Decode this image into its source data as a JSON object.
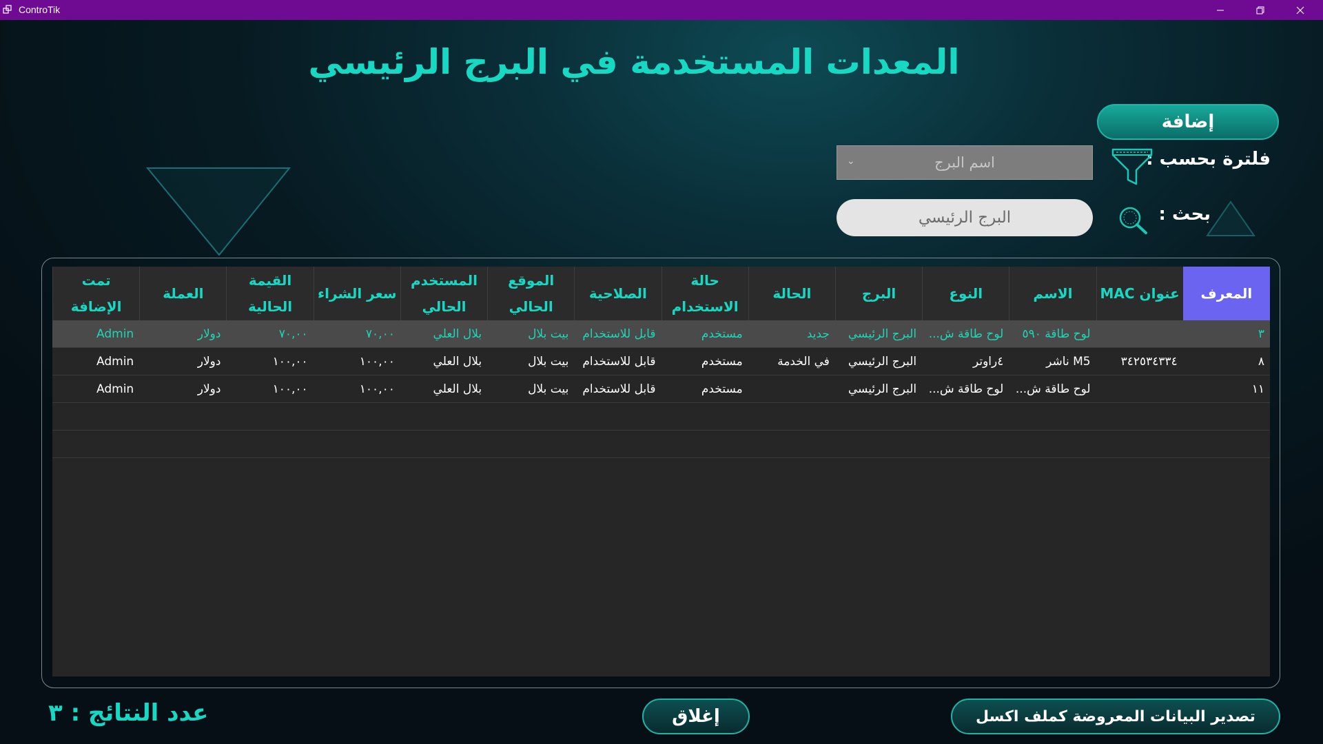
{
  "window": {
    "app_title": "ControTik",
    "accent_color": "#6e0b92"
  },
  "page": {
    "title": "المعدات المستخدمة في البرج الرئيسي",
    "add_button": "إضافة",
    "filter_label": "فلترة بحسب :",
    "filter_placeholder": "اسم البرج",
    "search_label": "بحث :",
    "search_value": "البرج الرئيسي",
    "results_label": "عدد النتائج : ٣",
    "close_button": "إغلاق",
    "export_button": "تصدير البيانات المعروضة كملف اكسل"
  },
  "table": {
    "columns": [
      {
        "key": "id",
        "label": "المعرف"
      },
      {
        "key": "mac",
        "label": "عنوان MAC"
      },
      {
        "key": "name",
        "label": "الاسم"
      },
      {
        "key": "type",
        "label": "النوع"
      },
      {
        "key": "tower",
        "label": "البرج"
      },
      {
        "key": "status",
        "label": "الحالة"
      },
      {
        "key": "usage",
        "label": "حالة الاستخدام"
      },
      {
        "key": "validity",
        "label": "الصلاحية"
      },
      {
        "key": "location",
        "label": "الموقع الحالي"
      },
      {
        "key": "user",
        "label": "المستخدم الحالي"
      },
      {
        "key": "purchase_price",
        "label": "سعر الشراء"
      },
      {
        "key": "current_value",
        "label": "القيمة الحالية"
      },
      {
        "key": "currency",
        "label": "العملة"
      },
      {
        "key": "added_by",
        "label": "تمت الإضافة"
      }
    ],
    "rows": [
      {
        "id": "٣",
        "mac": "",
        "name": "لوح طاقة ٥٩٠",
        "type": "لوح طاقة ش...",
        "tower": "البرج الرئيسي",
        "status": "جديد",
        "usage": "مستخدم",
        "validity": "قابل للاستخدام",
        "location": "بيت بلال",
        "user": "بلال العلي",
        "purchase_price": "٧٠,٠٠",
        "current_value": "٧٠,٠٠",
        "currency": "دولار",
        "added_by": "Admin",
        "highlighted": true
      },
      {
        "id": "٨",
        "mac": "٣٤٢٥٣٤٣٣٤",
        "name": "M5 ناشر",
        "type": "٤راوتر",
        "tower": "البرج الرئيسي",
        "status": "في الخدمة",
        "usage": "مستخدم",
        "validity": "قابل للاستخدام",
        "location": "بيت بلال",
        "user": "بلال العلي",
        "purchase_price": "١٠٠,٠٠",
        "current_value": "١٠٠,٠٠",
        "currency": "دولار",
        "added_by": "Admin",
        "highlighted": false
      },
      {
        "id": "١١",
        "mac": "",
        "name": "لوح طاقة ش...",
        "type": "لوح طاقة ش...",
        "tower": "البرج الرئيسي",
        "status": "",
        "usage": "مستخدم",
        "validity": "قابل للاستخدام",
        "location": "بيت بلال",
        "user": "بلال العلي",
        "purchase_price": "١٠٠,٠٠",
        "current_value": "١٠٠,٠٠",
        "currency": "دولار",
        "added_by": "Admin",
        "highlighted": false
      }
    ]
  }
}
